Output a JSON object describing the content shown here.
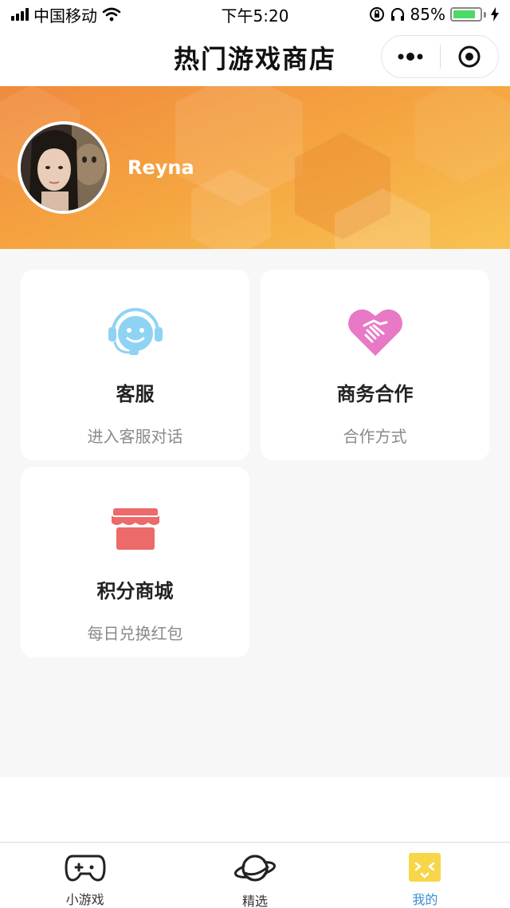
{
  "status_bar": {
    "carrier": "中国移动",
    "time": "下午5:20",
    "battery_percent": "85%",
    "battery_level": 0.85
  },
  "nav": {
    "title": "热门游戏商店",
    "more_icon": "more-dots-icon",
    "close_icon": "target-circle-icon"
  },
  "profile": {
    "username": "Reyna",
    "avatar": "avatar"
  },
  "cards": [
    {
      "title": "客服",
      "subtitle": "进入客服对话",
      "icon": "customer-service-icon",
      "color": "#8fd3f4"
    },
    {
      "title": "商务合作",
      "subtitle": "合作方式",
      "icon": "handshake-heart-icon",
      "color": "#e879c6"
    },
    {
      "title": "积分商城",
      "subtitle": "每日兑换红包",
      "icon": "shop-icon",
      "color": "#ec6a6a"
    }
  ],
  "tabs": [
    {
      "label": "小游戏",
      "icon": "gamepad-icon",
      "active": false
    },
    {
      "label": "精选",
      "icon": "planet-icon",
      "active": false
    },
    {
      "label": "我的",
      "icon": "face-icon",
      "active": true
    }
  ],
  "colors": {
    "banner_start": "#f08a3e",
    "banner_end": "#f8c253",
    "active_tab": "#3b8ed8"
  }
}
